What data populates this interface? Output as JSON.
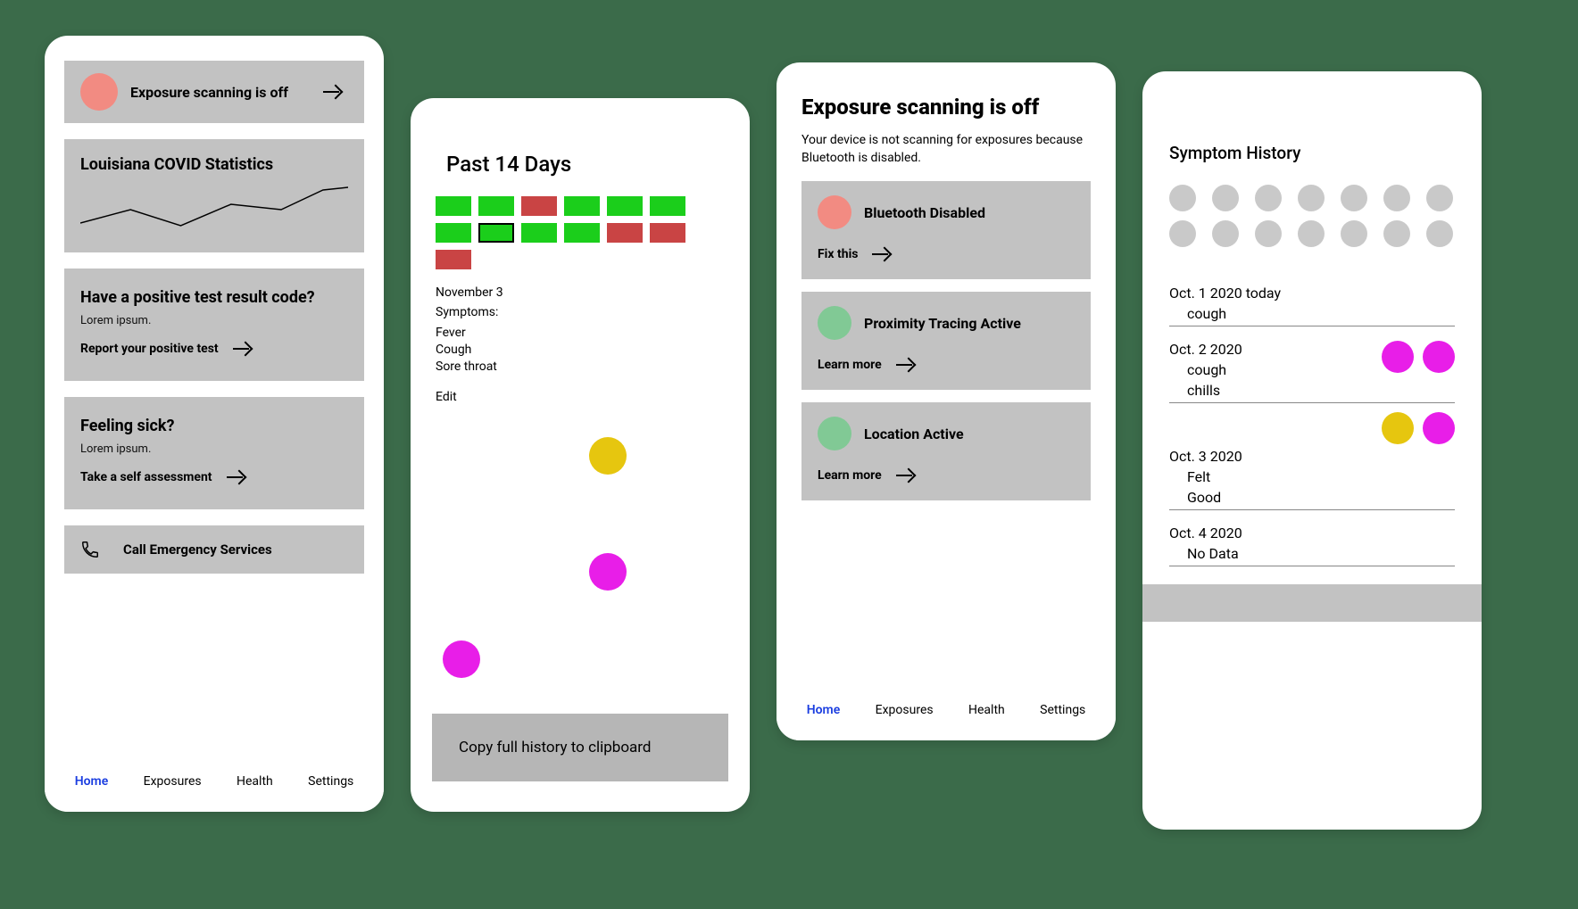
{
  "screen1": {
    "status_banner": {
      "label": "Exposure scanning is off"
    },
    "stats_card": {
      "title": "Louisiana COVID Statistics"
    },
    "positive_card": {
      "title": "Have a positive test result code?",
      "subtitle": "Lorem ipsum.",
      "action": "Report your positive test"
    },
    "sick_card": {
      "title": "Feeling sick?",
      "subtitle": "Lorem ipsum.",
      "action": "Take a self assessment"
    },
    "emergency": {
      "label": "Call Emergency Services"
    },
    "nav": {
      "home": "Home",
      "exposures": "Exposures",
      "health": "Health",
      "settings": "Settings"
    }
  },
  "screen2": {
    "title": "Past 14 Days",
    "days": [
      "g",
      "g",
      "r",
      "g",
      "g",
      "g",
      "g",
      "outline",
      "g",
      "g",
      "r",
      "r",
      "r"
    ],
    "selected_date": "November 3",
    "symptoms_label": "Symptoms:",
    "symptoms": [
      "Fever",
      "Cough",
      "Sore throat"
    ],
    "edit": "Edit",
    "copy_button": "Copy full history to clipboard"
  },
  "screen3": {
    "title": "Exposure scanning is off",
    "description": "Your device is not scanning for exposures because Bluetooth is disabled.",
    "cards": [
      {
        "color": "red",
        "label": "Bluetooth Disabled",
        "action": "Fix this"
      },
      {
        "color": "green",
        "label": "Proximity Tracing Active",
        "action": "Learn more"
      },
      {
        "color": "green",
        "label": "Location Active",
        "action": "Learn more"
      }
    ],
    "nav": {
      "home": "Home",
      "exposures": "Exposures",
      "health": "Health",
      "settings": "Settings"
    }
  },
  "screen4": {
    "title": "Symptom History",
    "rows": [
      {
        "date": "Oct. 1 2020 today",
        "symptoms": [
          "cough"
        ],
        "dots": []
      },
      {
        "date": "Oct. 2 2020",
        "symptoms": [
          "cough",
          "chills"
        ],
        "dots": [
          "m",
          "m"
        ]
      },
      {
        "date": "Oct. 3 2020",
        "symptoms": [
          "Felt",
          "Good"
        ],
        "dots": [
          "y",
          "m"
        ],
        "dots_above": true
      },
      {
        "date": "Oct. 4 2020",
        "symptoms": [
          "No Data"
        ],
        "dots": []
      }
    ]
  }
}
